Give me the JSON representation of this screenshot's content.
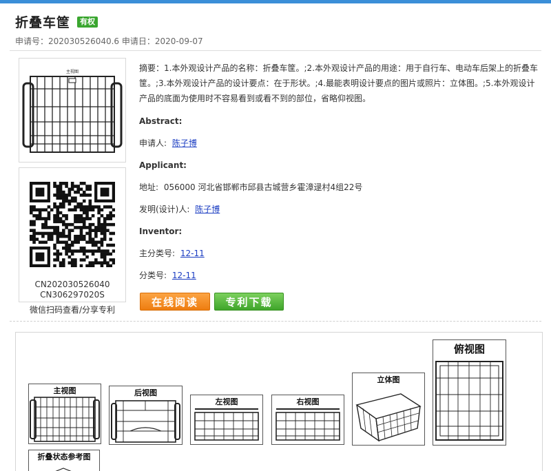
{
  "title": "折叠车筐",
  "badge": "有权",
  "meta": "申请号：202030526040.6 申请日：2020-09-07",
  "product_image_label": "主视图",
  "qr": {
    "line1": "CN202030526040",
    "line2": "CN306297020S",
    "caption": "微信扫码查看/分享专利"
  },
  "abstract_text": "摘要：1.本外观设计产品的名称：折叠车筐。;2.本外观设计产品的用途：用于自行车、电动车后架上的折叠车筐。;3.本外观设计产品的设计要点：在于形状。;4.最能表明设计要点的图片或照片：立体图。;5.本外观设计产品的底面为使用时不容易看到或看不到的部位，省略仰视图。",
  "fields": {
    "abstract_label": "Abstract:",
    "applicant_cn_label": "申请人:",
    "applicant_cn_value": "陈子博",
    "applicant_label": "Applicant:",
    "address_label": "地址:",
    "address_value": "056000 河北省邯郸市邱县古城营乡霍漳逯村4组22号",
    "inventor_cn_label": "发明(设计)人:",
    "inventor_cn_value": "陈子博",
    "inventor_label": "Inventor:",
    "main_class_label": "主分类号:",
    "main_class_value": "12-11",
    "class_label": "分类号:",
    "class_value": "12-11"
  },
  "buttons": {
    "read": "在线阅读",
    "download": "专利下载"
  },
  "views": {
    "front": "主视图",
    "rear": "后视图",
    "left": "左视图",
    "right": "右视图",
    "perspective": "立体图",
    "top": "俯视图",
    "folded": "折叠状态参考图"
  },
  "colors": {
    "accent_bar": "#3b8fd8",
    "badge": "#3aa62f",
    "read_button": "#f08a1c",
    "download_button": "#4caf36",
    "link": "#1a3cc2"
  }
}
